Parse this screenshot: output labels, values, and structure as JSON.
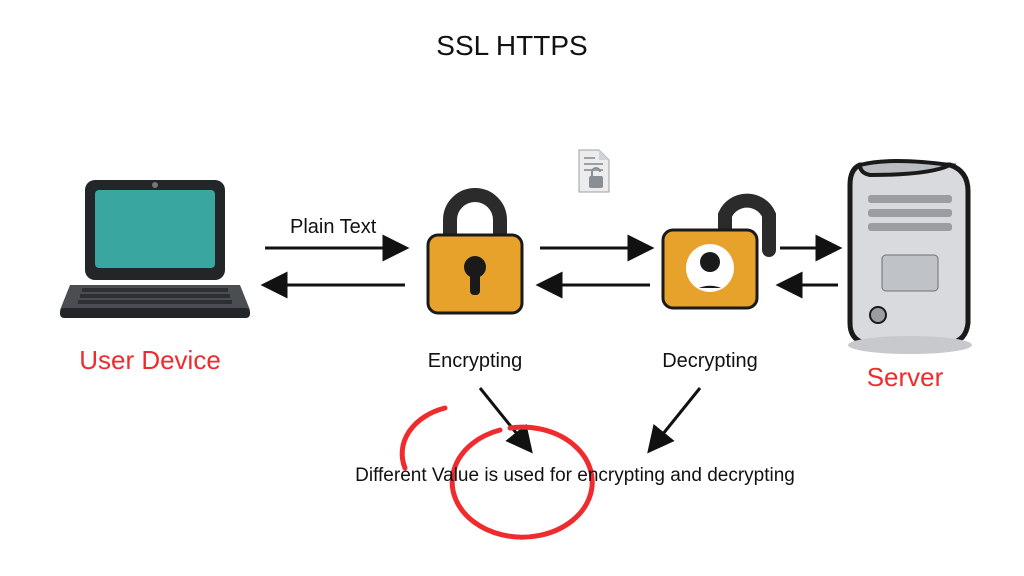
{
  "title": "SSL HTTPS",
  "nodes": {
    "user_device": "User Device",
    "encrypting": "Encrypting",
    "decrypting": "Decrypting",
    "server": "Server"
  },
  "arrows": {
    "plain_text": "Plain Text"
  },
  "note": "Different Value is used for encrypting and decrypting"
}
